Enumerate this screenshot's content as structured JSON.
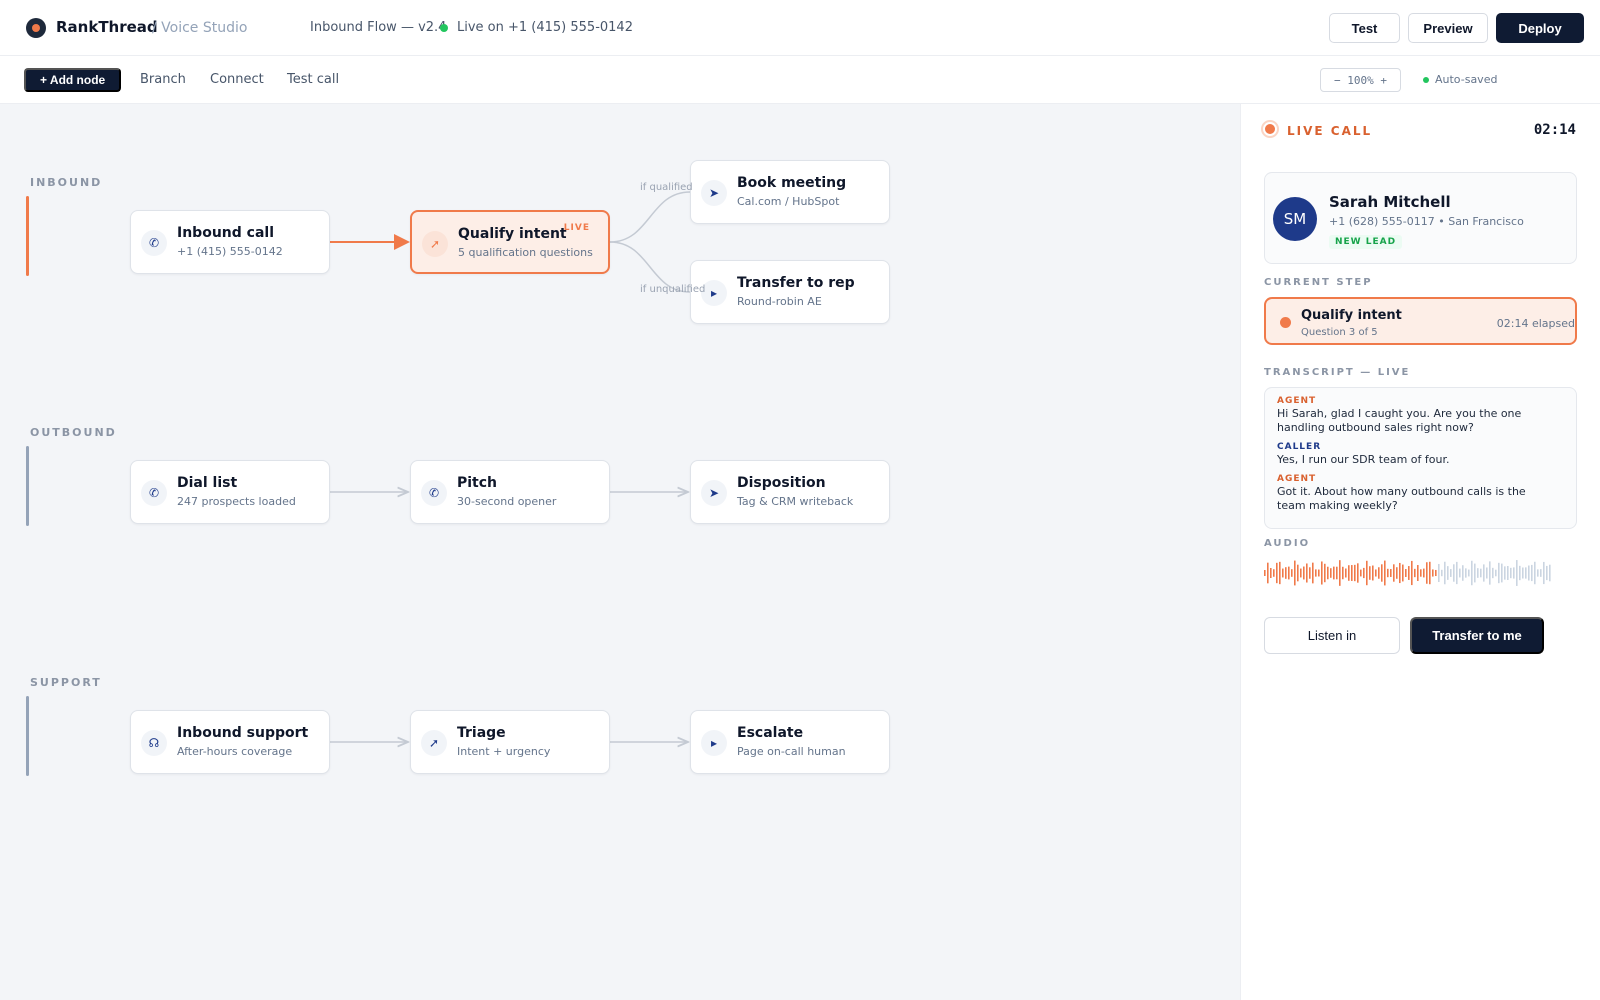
{
  "header": {
    "brand": "RankThread",
    "brand_sub": "/ Voice Studio",
    "flow_name": "Inbound Flow — v2.4",
    "live_number": "Live on +1 (415) 555-0142",
    "buttons": {
      "test": "Test",
      "preview": "Preview",
      "deploy": "Deploy"
    }
  },
  "toolbar": {
    "add_node": "+ Add node",
    "branch": "Branch",
    "connect": "Connect",
    "test_call": "Test call",
    "zoom": "−  100%  +",
    "saved": "Auto-saved"
  },
  "canvas": {
    "lanes": [
      {
        "label": "INBOUND",
        "color": "#f07a4a",
        "nodes": [
          {
            "title": "Inbound call",
            "sub": "+1 (415) 555-0142",
            "icon": "phone-icon"
          },
          {
            "title": "Qualify intent",
            "sub": "5 qualification questions",
            "icon": "cursor-icon",
            "badge": "LIVE"
          },
          {
            "title": "Book meeting",
            "sub": "Cal.com / HubSpot",
            "icon": "send-icon"
          },
          {
            "title": "Transfer to rep",
            "sub": "Round-robin AE",
            "icon": "play-icon"
          }
        ],
        "branch_labels": [
          "if qualified",
          "if unqualified"
        ]
      },
      {
        "label": "OUTBOUND",
        "color": "#94a3b8",
        "nodes": [
          {
            "title": "Dial list",
            "sub": "247 prospects loaded",
            "icon": "phone-out-icon"
          },
          {
            "title": "Pitch",
            "sub": "30-second opener",
            "icon": "phone-icon"
          },
          {
            "title": "Disposition",
            "sub": "Tag & CRM writeback",
            "icon": "send-icon"
          }
        ]
      },
      {
        "label": "SUPPORT",
        "color": "#94a3b8",
        "nodes": [
          {
            "title": "Inbound support",
            "sub": "After-hours coverage",
            "icon": "headset-icon"
          },
          {
            "title": "Triage",
            "sub": "Intent + urgency",
            "icon": "cursor-icon"
          },
          {
            "title": "Escalate",
            "sub": "Page on-call human",
            "icon": "play-icon"
          }
        ]
      }
    ]
  },
  "panel": {
    "live_label": "LIVE CALL",
    "timer": "02:14",
    "caller": {
      "initials": "SM",
      "name": "Sarah Mitchell",
      "info": "+1 (628) 555-0117 • San Francisco",
      "badge": "NEW LEAD"
    },
    "current_step_label": "CURRENT STEP",
    "current_step": {
      "title": "Qualify intent",
      "sub": "Question 3 of 5",
      "elapsed": "02:14 elapsed"
    },
    "transcript_label": "TRANSCRIPT — LIVE",
    "transcript": [
      {
        "speaker": "AGENT",
        "text": "Hi Sarah, glad I caught you. Are you the one handling outbound sales right now?"
      },
      {
        "speaker": "CALLER",
        "text": "Yes, I run our SDR team of four."
      },
      {
        "speaker": "AGENT",
        "text": "Got it. About how many outbound calls is the team making weekly?"
      }
    ],
    "audio_label": "AUDIO",
    "audio": {
      "played_fraction": 0.6,
      "played_color": "#f07a4a",
      "unplayed_color": "#cbd5e1"
    },
    "buttons": {
      "listen": "Listen in",
      "transfer": "Transfer to me"
    }
  },
  "colors": {
    "accent": "#f07a4a",
    "navy": "#0f1b33",
    "success": "#22c55e"
  }
}
